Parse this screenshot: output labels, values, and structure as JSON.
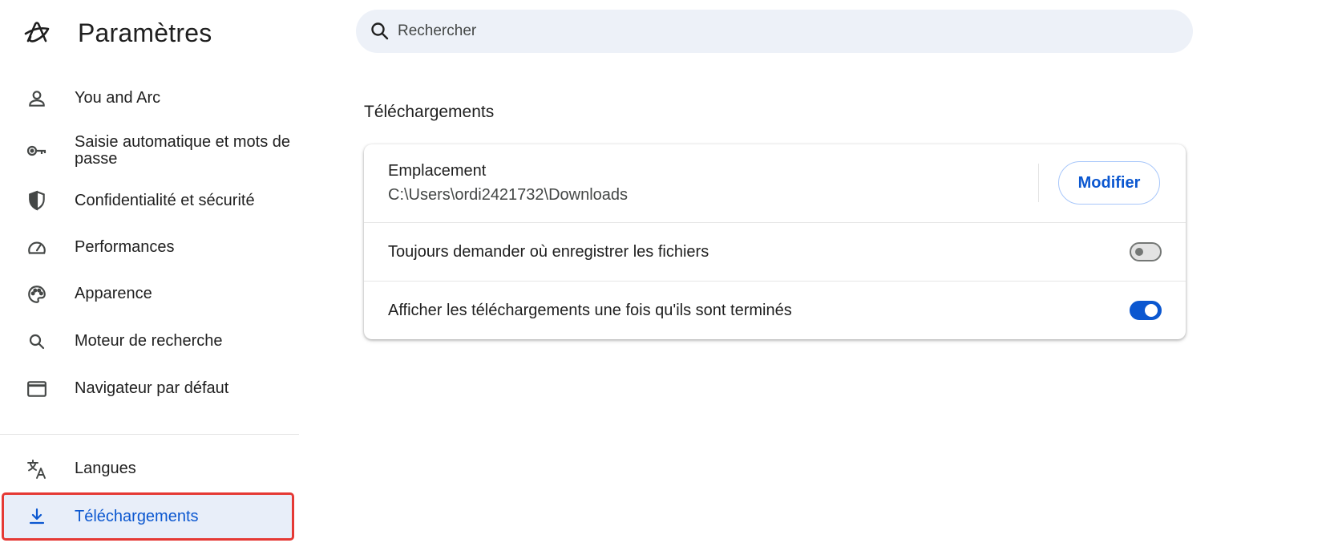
{
  "sidebar": {
    "brand_title": "Paramètres",
    "items": [
      {
        "label": "You and Arc",
        "icon": "person-icon"
      },
      {
        "label": "Saisie automatique et mots de passe",
        "icon": "key-icon"
      },
      {
        "label": "Confidentialité et sécurité",
        "icon": "shield-icon"
      },
      {
        "label": "Performances",
        "icon": "speedometer-icon"
      },
      {
        "label": "Apparence",
        "icon": "palette-icon"
      },
      {
        "label": "Moteur de recherche",
        "icon": "search-icon"
      },
      {
        "label": "Navigateur par défaut",
        "icon": "browser-window-icon"
      },
      {
        "label": "Langues",
        "icon": "translate-icon"
      },
      {
        "label": "Téléchargements",
        "icon": "download-icon",
        "active": true
      }
    ]
  },
  "search": {
    "placeholder": "Rechercher"
  },
  "main": {
    "section_title": "Téléchargements",
    "location": {
      "title": "Emplacement",
      "path": "C:\\Users\\ordi2421732\\Downloads",
      "button_label": "Modifier"
    },
    "ask_where": {
      "label": "Toujours demander où enregistrer les fichiers",
      "enabled": false
    },
    "show_when_done": {
      "label": "Afficher les téléchargements une fois qu'ils sont terminés",
      "enabled": true
    }
  },
  "colors": {
    "accent": "#0b57d0",
    "active_bg": "#e8eef9",
    "highlight_border": "#e53935"
  }
}
